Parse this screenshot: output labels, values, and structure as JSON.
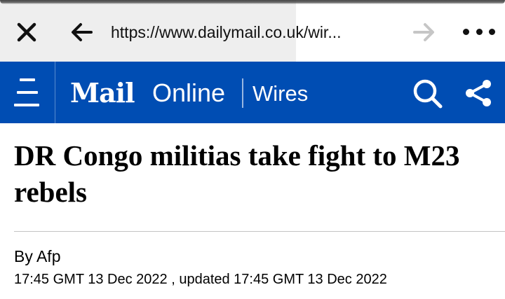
{
  "colors": {
    "brand": "#004db3",
    "header_text": "#ffffff",
    "text": "#000000"
  },
  "browser": {
    "close_icon": "close-icon",
    "back_icon": "arrow-left-icon",
    "url": "https://www.dailymail.co.uk/wir...",
    "forward_icon": "arrow-right-icon",
    "more_icon": "more-horizontal-icon"
  },
  "site_header": {
    "menu_icon": "menu-icon",
    "logo_mail": "Mail",
    "logo_online": "Online",
    "section": "Wires",
    "search_icon": "search-icon",
    "share_icon": "share-icon"
  },
  "article": {
    "headline": "DR Congo militias take fight to M23 rebels",
    "byline": "By Afp",
    "timestamp": "17:45 GMT 13 Dec 2022 , updated 17:45 GMT 13 Dec 2022"
  }
}
